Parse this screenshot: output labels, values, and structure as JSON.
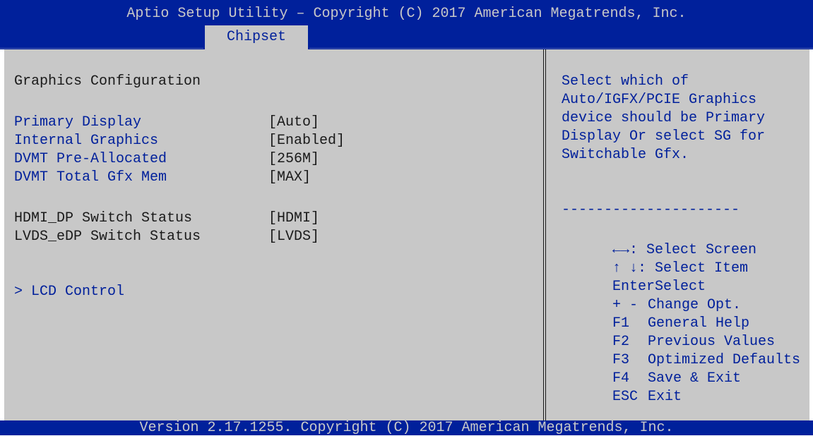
{
  "header": {
    "title": "Aptio Setup Utility – Copyright (C) 2017 American Megatrends, Inc.",
    "active_tab": "Chipset"
  },
  "main": {
    "section_title": "Graphics Configuration",
    "settings": [
      {
        "label": "Primary Display",
        "value": "[Auto]"
      },
      {
        "label": "Internal Graphics",
        "value": "[Enabled]"
      },
      {
        "label": "DVMT Pre-Allocated",
        "value": "[256M]"
      },
      {
        "label": "DVMT Total Gfx Mem",
        "value": "[MAX]"
      }
    ],
    "status": [
      {
        "label": "HDMI_DP Switch Status",
        "value": "[HDMI]"
      },
      {
        "label": "LVDS_eDP Switch Status",
        "value": "[LVDS]"
      }
    ],
    "submenu": "> LCD Control"
  },
  "help": {
    "lines": [
      "Select which of",
      "Auto/IGFX/PCIE Graphics",
      "device should be Primary",
      "Display Or select SG for",
      "Switchable Gfx."
    ],
    "separator": "---------------------",
    "keys": [
      {
        "key": "←→",
        "desc": ": Select Screen"
      },
      {
        "key": "↑ ↓",
        "desc": ": Select Item"
      },
      {
        "key": "Enter",
        "desc": "Select"
      },
      {
        "key": "+ -",
        "desc": "Change Opt."
      },
      {
        "key": "F1",
        "desc": "General Help"
      },
      {
        "key": "F2",
        "desc": "Previous Values"
      },
      {
        "key": "F3",
        "desc": "Optimized Defaults"
      },
      {
        "key": "F4",
        "desc": "Save & Exit"
      },
      {
        "key": "ESC",
        "desc": "Exit"
      }
    ]
  },
  "footer": {
    "text": "Version 2.17.1255. Copyright (C) 2017 American Megatrends, Inc."
  },
  "colors": {
    "bios_blue": "#00209b",
    "bios_gray": "#c8c8c8",
    "text_dark": "#1a1a1a"
  }
}
